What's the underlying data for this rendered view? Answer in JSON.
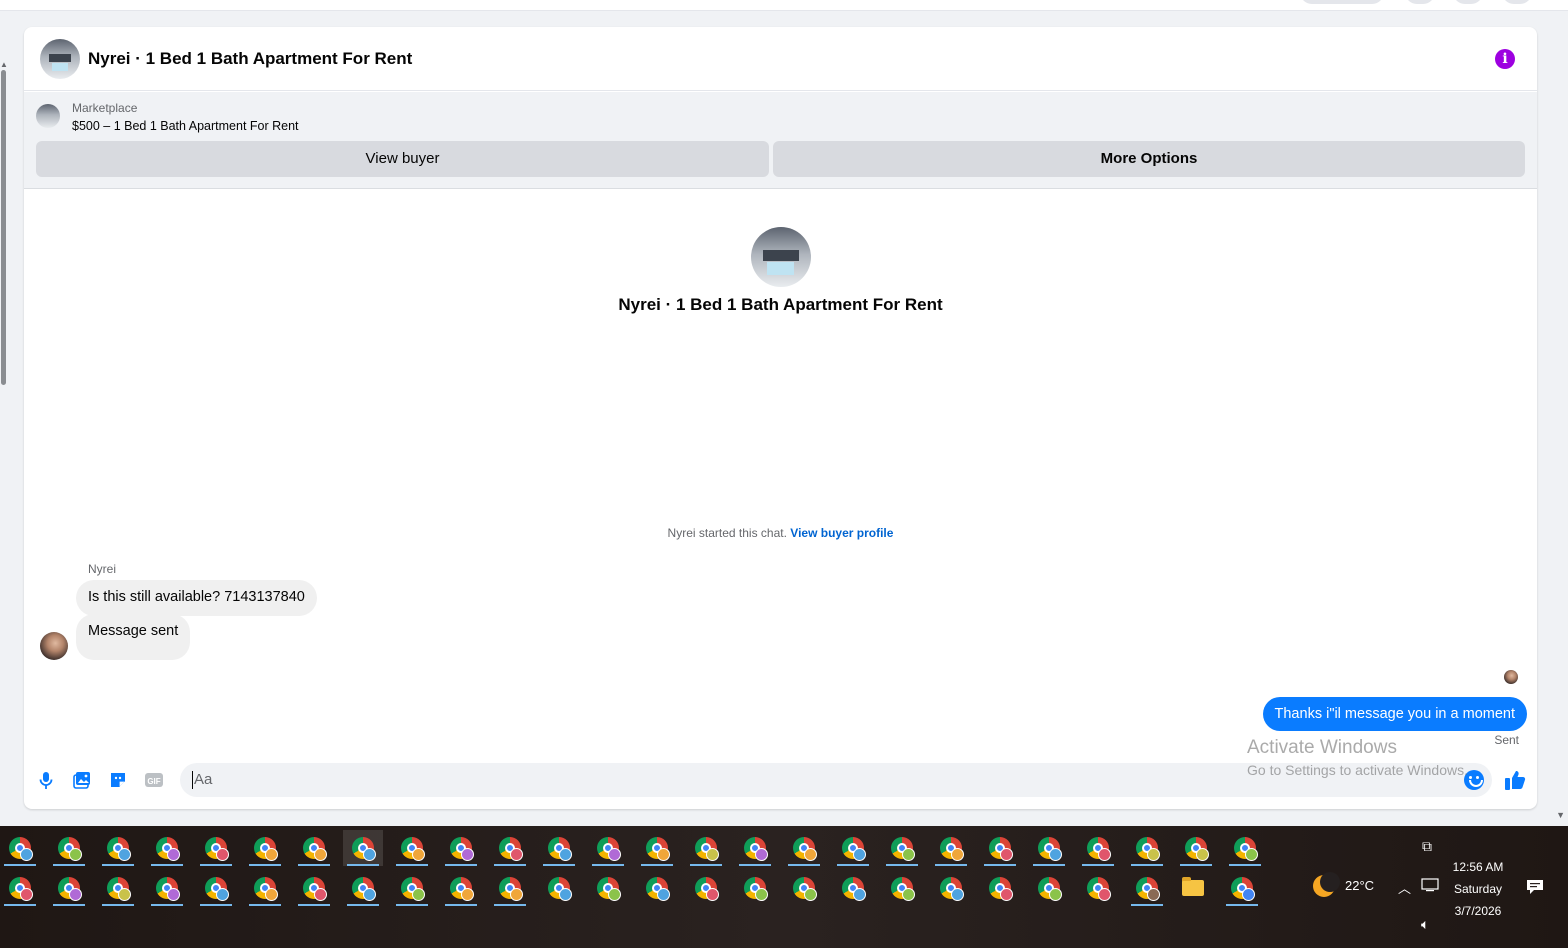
{
  "header": {
    "title": "Nyrei · 1 Bed 1 Bath Apartment For Rent",
    "info_icon": "i"
  },
  "marketplace": {
    "label": "Marketplace",
    "listing": "$500 – 1 Bed 1 Bath Apartment For Rent",
    "view_buyer_label": "View buyer",
    "more_options_label": "More Options"
  },
  "intro": {
    "title": "Nyrei · 1 Bed 1 Bath Apartment For Rent"
  },
  "thread": {
    "started_text": "Nyrei started this chat.",
    "view_profile_link": "View buyer profile",
    "sender_name": "Nyrei",
    "incoming": [
      "Is this still available? 7143137840",
      "Message sent"
    ],
    "outgoing": "Thanks i\"il message you in a moment",
    "status": "Sent"
  },
  "composer": {
    "placeholder": "Aa",
    "icons": [
      "microphone-icon",
      "image-icon",
      "sticker-icon",
      "gif-icon",
      "emoji-icon",
      "like-icon"
    ],
    "gif_label": "GIF"
  },
  "watermark": {
    "line1": "Activate Windows",
    "line2": "Go to Settings to activate Windows."
  },
  "taskbar": {
    "weather": "22°C",
    "time": "12:56 AM",
    "day": "Saturday",
    "date": "3/7/2026"
  },
  "colors": {
    "accent": "#0a7cff",
    "info": "#9d00e0",
    "link": "#0064d1",
    "panel_bg": "#ffffff",
    "page_bg": "#f0f2f5",
    "bubble_incoming": "#f0f0f0"
  }
}
